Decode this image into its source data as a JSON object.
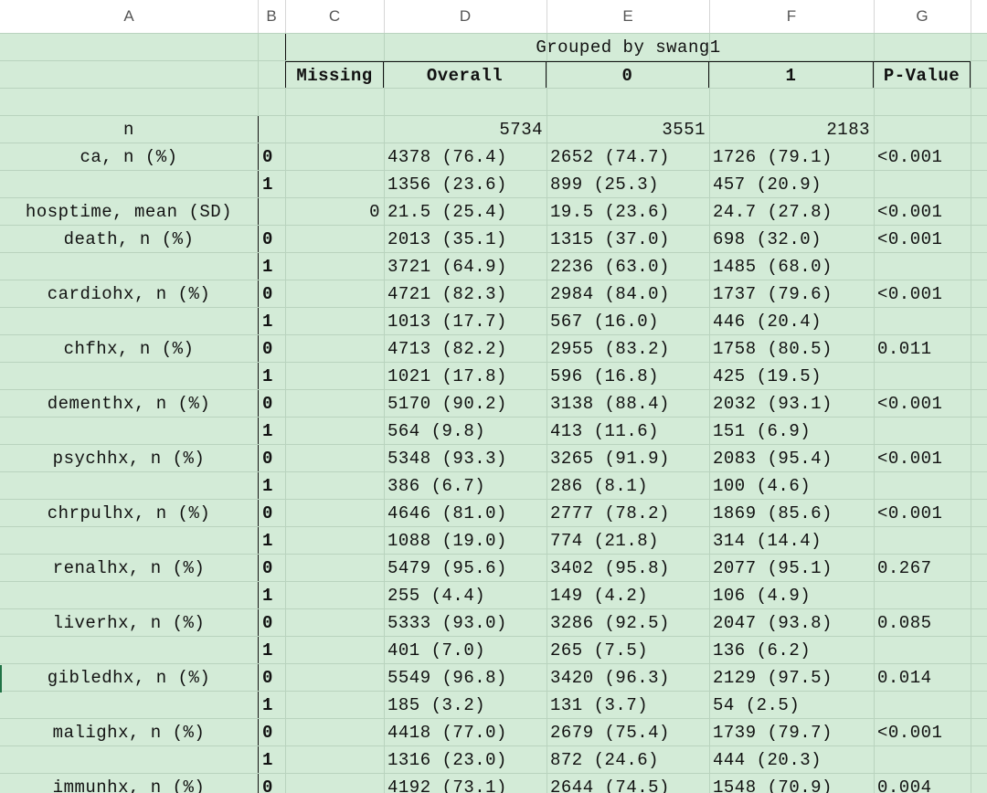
{
  "columns": [
    "A",
    "B",
    "C",
    "D",
    "E",
    "F",
    "G"
  ],
  "header": {
    "grouped_by": "Grouped by swang1",
    "missing": "Missing",
    "overall": "Overall",
    "group0": "0",
    "group1": "1",
    "pvalue": "P-Value"
  },
  "n_row": {
    "label": "n",
    "overall": "5734",
    "g0": "3551",
    "g1": "2183"
  },
  "hosptime": {
    "label": "hosptime, mean (SD)",
    "missing": "0",
    "overall": "21.5 (25.4)",
    "g0": "19.5 (23.6)",
    "g1": "24.7 (27.8)",
    "p": "<0.001"
  },
  "variables": [
    {
      "label": "ca, n (%)",
      "levels": [
        {
          "lvl": "0",
          "overall": "4378 (76.4)",
          "g0": "2652 (74.7)",
          "g1": "1726 (79.1)",
          "p": "<0.001"
        },
        {
          "lvl": "1",
          "overall": "1356 (23.6)",
          "g0": "899 (25.3)",
          "g1": "457 (20.9)",
          "p": ""
        }
      ]
    },
    {
      "label": "death, n (%)",
      "levels": [
        {
          "lvl": "0",
          "overall": "2013 (35.1)",
          "g0": "1315 (37.0)",
          "g1": "698 (32.0)",
          "p": "<0.001"
        },
        {
          "lvl": "1",
          "overall": "3721 (64.9)",
          "g0": "2236 (63.0)",
          "g1": "1485 (68.0)",
          "p": ""
        }
      ]
    },
    {
      "label": "cardiohx, n (%)",
      "levels": [
        {
          "lvl": "0",
          "overall": "4721 (82.3)",
          "g0": "2984 (84.0)",
          "g1": "1737 (79.6)",
          "p": "<0.001"
        },
        {
          "lvl": "1",
          "overall": "1013 (17.7)",
          "g0": "567 (16.0)",
          "g1": "446 (20.4)",
          "p": ""
        }
      ]
    },
    {
      "label": "chfhx, n (%)",
      "levels": [
        {
          "lvl": "0",
          "overall": "4713 (82.2)",
          "g0": "2955 (83.2)",
          "g1": "1758 (80.5)",
          "p": "0.011"
        },
        {
          "lvl": "1",
          "overall": "1021 (17.8)",
          "g0": "596 (16.8)",
          "g1": "425 (19.5)",
          "p": ""
        }
      ]
    },
    {
      "label": "dementhx, n (%)",
      "levels": [
        {
          "lvl": "0",
          "overall": "5170 (90.2)",
          "g0": "3138 (88.4)",
          "g1": "2032 (93.1)",
          "p": "<0.001"
        },
        {
          "lvl": "1",
          "overall": "564 (9.8)",
          "g0": "413 (11.6)",
          "g1": "151 (6.9)",
          "p": ""
        }
      ]
    },
    {
      "label": "psychhx, n (%)",
      "levels": [
        {
          "lvl": "0",
          "overall": "5348 (93.3)",
          "g0": "3265 (91.9)",
          "g1": "2083 (95.4)",
          "p": "<0.001"
        },
        {
          "lvl": "1",
          "overall": "386 (6.7)",
          "g0": "286 (8.1)",
          "g1": "100 (4.6)",
          "p": ""
        }
      ]
    },
    {
      "label": "chrpulhx, n (%)",
      "levels": [
        {
          "lvl": "0",
          "overall": "4646 (81.0)",
          "g0": "2777 (78.2)",
          "g1": "1869 (85.6)",
          "p": "<0.001"
        },
        {
          "lvl": "1",
          "overall": "1088 (19.0)",
          "g0": "774 (21.8)",
          "g1": "314 (14.4)",
          "p": ""
        }
      ]
    },
    {
      "label": "renalhx, n (%)",
      "levels": [
        {
          "lvl": "0",
          "overall": "5479 (95.6)",
          "g0": "3402 (95.8)",
          "g1": "2077 (95.1)",
          "p": "0.267"
        },
        {
          "lvl": "1",
          "overall": "255 (4.4)",
          "g0": "149 (4.2)",
          "g1": "106 (4.9)",
          "p": ""
        }
      ]
    },
    {
      "label": "liverhx, n (%)",
      "levels": [
        {
          "lvl": "0",
          "overall": "5333 (93.0)",
          "g0": "3286 (92.5)",
          "g1": "2047 (93.8)",
          "p": "0.085"
        },
        {
          "lvl": "1",
          "overall": "401 (7.0)",
          "g0": "265 (7.5)",
          "g1": "136 (6.2)",
          "p": ""
        }
      ]
    },
    {
      "label": "gibledhx, n (%)",
      "levels": [
        {
          "lvl": "0",
          "overall": "5549 (96.8)",
          "g0": "3420 (96.3)",
          "g1": "2129 (97.5)",
          "p": "0.014"
        },
        {
          "lvl": "1",
          "overall": "185 (3.2)",
          "g0": "131 (3.7)",
          "g1": "54 (2.5)",
          "p": ""
        }
      ]
    },
    {
      "label": "malighx, n (%)",
      "levels": [
        {
          "lvl": "0",
          "overall": "4418 (77.0)",
          "g0": "2679 (75.4)",
          "g1": "1739 (79.7)",
          "p": "<0.001"
        },
        {
          "lvl": "1",
          "overall": "1316 (23.0)",
          "g0": "872 (24.6)",
          "g1": "444 (20.3)",
          "p": ""
        }
      ]
    },
    {
      "label": "immunhx, n (%)",
      "levels": [
        {
          "lvl": "0",
          "overall": "4192 (73.1)",
          "g0": "2644 (74.5)",
          "g1": "1548 (70.9)",
          "p": "0.004"
        }
      ]
    }
  ]
}
